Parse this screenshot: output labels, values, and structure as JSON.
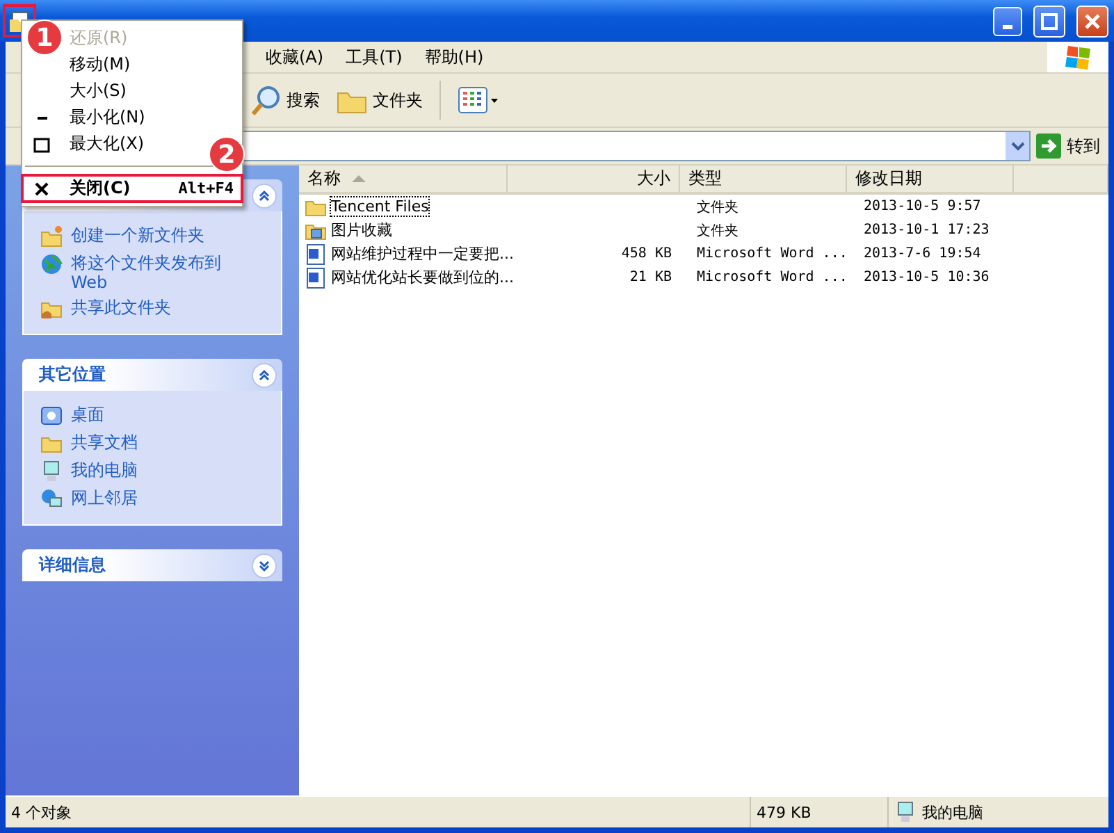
{
  "window": {
    "icon_highlighted": true
  },
  "menu_bar": [
    {
      "label": "收藏(A)"
    },
    {
      "label": "工具(T)"
    },
    {
      "label": "帮助(H)"
    }
  ],
  "toolbar": [
    {
      "label": "搜索",
      "kind": "search"
    },
    {
      "label": "文件夹",
      "kind": "folders"
    },
    {
      "kind": "views"
    }
  ],
  "address_bar": {
    "go_label": "转到"
  },
  "task_panels": [
    {
      "expanded": true,
      "items": [
        {
          "label": "创建一个新文件夹",
          "kind": "new-folder"
        },
        {
          "label": "将这个文件夹发布到 Web",
          "kind": "publish"
        },
        {
          "label": "共享此文件夹",
          "kind": "share"
        }
      ]
    },
    {
      "title": "其它位置",
      "expanded": true,
      "items": [
        {
          "label": "桌面",
          "kind": "desktop"
        },
        {
          "label": "共享文档",
          "kind": "folder"
        },
        {
          "label": "我的电脑",
          "kind": "computer"
        },
        {
          "label": "网上邻居",
          "kind": "network"
        }
      ]
    },
    {
      "title": "详细信息",
      "expanded": false
    }
  ],
  "files": {
    "columns": [
      {
        "label": "名称",
        "sorted": true
      },
      {
        "label": "大小",
        "sorted": false
      },
      {
        "label": "类型",
        "sorted": false
      },
      {
        "label": "修改日期",
        "sorted": false
      }
    ],
    "rows": [
      {
        "name": "Tencent Files",
        "size": "",
        "type": "文件夹",
        "modified": "2013-10-5 9:57",
        "kind": "folder",
        "focused": true
      },
      {
        "name": "图片收藏",
        "size": "",
        "type": "文件夹",
        "modified": "2013-10-1 17:23",
        "kind": "picture-folder",
        "focused": false
      },
      {
        "name": "网站维护过程中一定要把...",
        "size": "458 KB",
        "type": "Microsoft Word ...",
        "modified": "2013-7-6 19:54",
        "kind": "word",
        "focused": false
      },
      {
        "name": "网站优化站长要做到位的...",
        "size": "21 KB",
        "type": "Microsoft Word ...",
        "modified": "2013-10-5 10:36",
        "kind": "word",
        "focused": false
      }
    ]
  },
  "status_bar": {
    "count": "4 个对象",
    "size": "479 KB",
    "location": "我的电脑"
  },
  "system_menu": {
    "items": [
      {
        "label": "还原(R)",
        "kind": "restore",
        "disabled": true,
        "highlighted": false
      },
      {
        "label": "移动(M)",
        "kind": "move",
        "disabled": false,
        "highlighted": false
      },
      {
        "label": "大小(S)",
        "kind": "size",
        "disabled": false,
        "highlighted": false
      },
      {
        "label": "最小化(N)",
        "kind": "minimize",
        "disabled": false,
        "highlighted": false
      },
      {
        "label": "最大化(X)",
        "kind": "maximize",
        "disabled": false,
        "highlighted": false
      },
      {
        "label": "关闭(C)",
        "kind": "close",
        "disabled": false,
        "highlighted": true,
        "shortcut": "Alt+F4"
      }
    ]
  },
  "annotations": [
    {
      "number": "1"
    },
    {
      "number": "2"
    }
  ]
}
